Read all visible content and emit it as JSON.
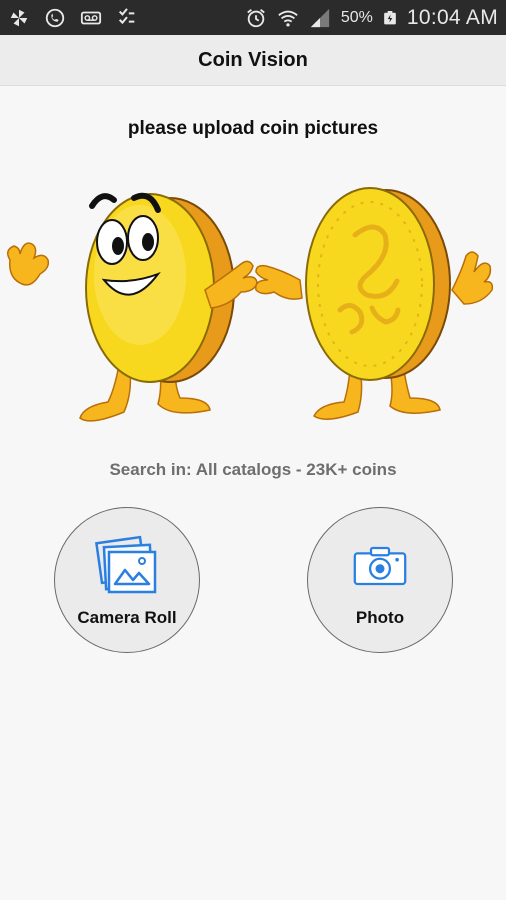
{
  "status_bar": {
    "battery_percent": "50%",
    "time": "10:04 AM",
    "icons": [
      "pinwheel-icon",
      "missed-call-icon",
      "voicemail-icon",
      "checklist-icon",
      "alarm-icon",
      "wifi-icon",
      "signal-icon",
      "battery-charging-icon"
    ]
  },
  "app_bar": {
    "title": "Coin Vision"
  },
  "instruction": "please upload coin pictures",
  "search": {
    "text": "Search in: All catalogs - 23K+ coins"
  },
  "buttons": {
    "camera_roll": {
      "label": "Camera Roll",
      "icon": "photo-gallery-icon"
    },
    "photo": {
      "label": "Photo",
      "icon": "camera-icon"
    }
  },
  "colors": {
    "accent_blue": "#2a7fe0",
    "coin_yellow": "#f8d81e",
    "coin_edge": "#e89a1a",
    "status_bar": "#2b2b2b"
  }
}
